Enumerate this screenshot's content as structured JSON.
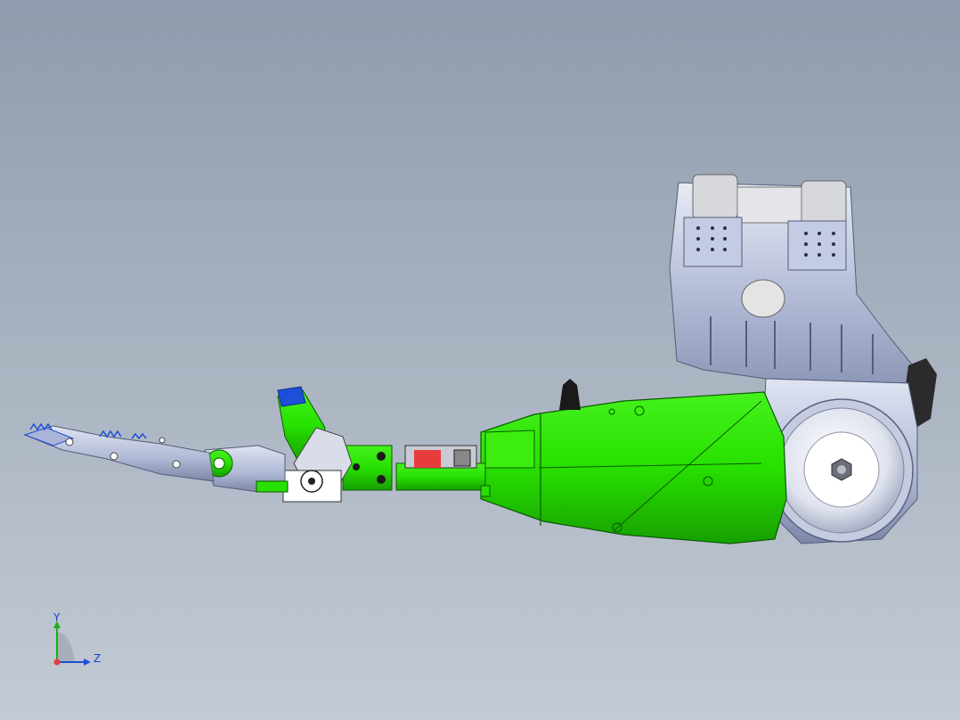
{
  "viewport": {
    "background_top": "#8e9cad",
    "background_bottom": "#c3cad4"
  },
  "model": {
    "colors": {
      "body_green": "#27e000",
      "body_green_dark": "#129600",
      "metal": "#b9c2dc",
      "metal_dark": "#6b7390",
      "accent_red": "#e83b3b",
      "accent_blue": "#1f4fd8",
      "cap_black": "#1a1a1a"
    }
  },
  "triad": {
    "y_label": "Y",
    "z_label": "Z",
    "icon": "axis-triad-icon"
  }
}
